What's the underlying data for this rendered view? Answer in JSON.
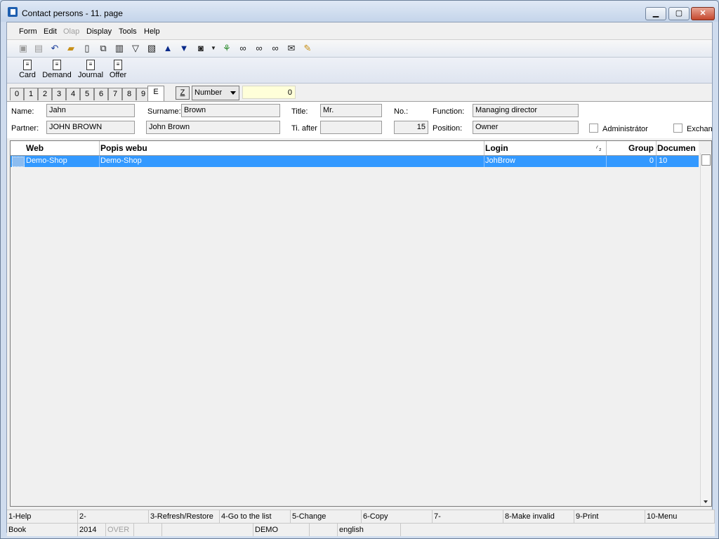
{
  "window": {
    "title": "Contact persons - 11. page",
    "min_label": "▁",
    "max_label": "▢",
    "close_label": "✕"
  },
  "menu": {
    "form": "Form",
    "edit": "Edit",
    "olap": "Olap",
    "display": "Display",
    "tools": "Tools",
    "help": "Help"
  },
  "toolbar2": {
    "card": "Card",
    "demand": "Demand",
    "journal": "Journal",
    "offer": "Offer"
  },
  "tabs": {
    "t0": "0",
    "t1": "1",
    "t2": "2",
    "t3": "3",
    "t4": "4",
    "t5": "5",
    "t6": "6",
    "t7": "7",
    "t8": "8",
    "t9": "9",
    "tE": "E",
    "z": "Z"
  },
  "sort": {
    "selected": "Number",
    "value": "0"
  },
  "form": {
    "name_label": "Name:",
    "name": "Jahn",
    "surname_label": "Surname:",
    "surname": "Brown",
    "title_label": "Title:",
    "title": "Mr.",
    "no_label": "No.:",
    "function_label": "Function:",
    "function": "Managing director",
    "partner_label": "Partner:",
    "partner": "JOHN BROWN",
    "partner_name": "John Brown",
    "ti_after_label": "Ti. after",
    "ti_after": "",
    "number": "15",
    "position_label": "Position:",
    "position": "Owner",
    "admin_label": "Administrátor",
    "exchange_label": "Exchan"
  },
  "grid": {
    "headers": {
      "web": "Web",
      "popis": "Popis webu",
      "login": "Login",
      "sort_mark": "⁄ ₂",
      "group": "Group",
      "document": "Documen"
    },
    "rows": [
      {
        "web": "Demo-Shop",
        "popis": "Demo-Shop",
        "login": "JohBrow",
        "group": "0",
        "document": "10"
      }
    ]
  },
  "fkeys": {
    "f1": "1-Help",
    "f2": "2-",
    "f3": "3-Refresh/Restore",
    "f4": "4-Go to the list",
    "f5": "5-Change",
    "f6": "6-Copy",
    "f7": "7-",
    "f8": "8-Make invalid",
    "f9": "9-Print",
    "f10": "10-Menu"
  },
  "status": {
    "book": "Book",
    "year": "2014",
    "over": "OVER",
    "db": "DEMO",
    "lang": "english"
  }
}
